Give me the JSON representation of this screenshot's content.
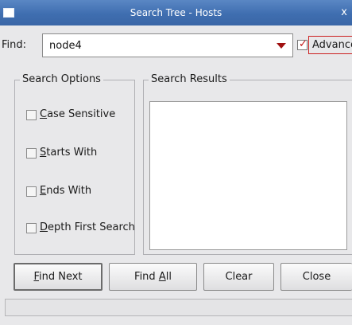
{
  "window": {
    "title": "Search Tree - Hosts",
    "close_glyph": "x"
  },
  "find": {
    "label": "Find:",
    "value": "node4",
    "advanced_label": "Advanced",
    "advanced_checked": true,
    "check_glyph": "✓"
  },
  "search_options": {
    "title": "Search Options",
    "items": [
      {
        "mnemonic": "C",
        "rest": "ase Sensitive",
        "checked": false
      },
      {
        "mnemonic": "S",
        "rest": "tarts With",
        "checked": false
      },
      {
        "mnemonic": "E",
        "rest": "nds With",
        "checked": false
      },
      {
        "mnemonic": "D",
        "rest": "epth First Search",
        "checked": false
      }
    ]
  },
  "search_results": {
    "title": "Search Results",
    "items": []
  },
  "buttons": {
    "find_next": {
      "mnemonic": "F",
      "rest": "ind Next"
    },
    "find_all": {
      "prefix": "Find ",
      "mnemonic": "A",
      "rest": "ll"
    },
    "clear": "Clear",
    "close": "Close"
  },
  "status": {
    "text": ""
  }
}
